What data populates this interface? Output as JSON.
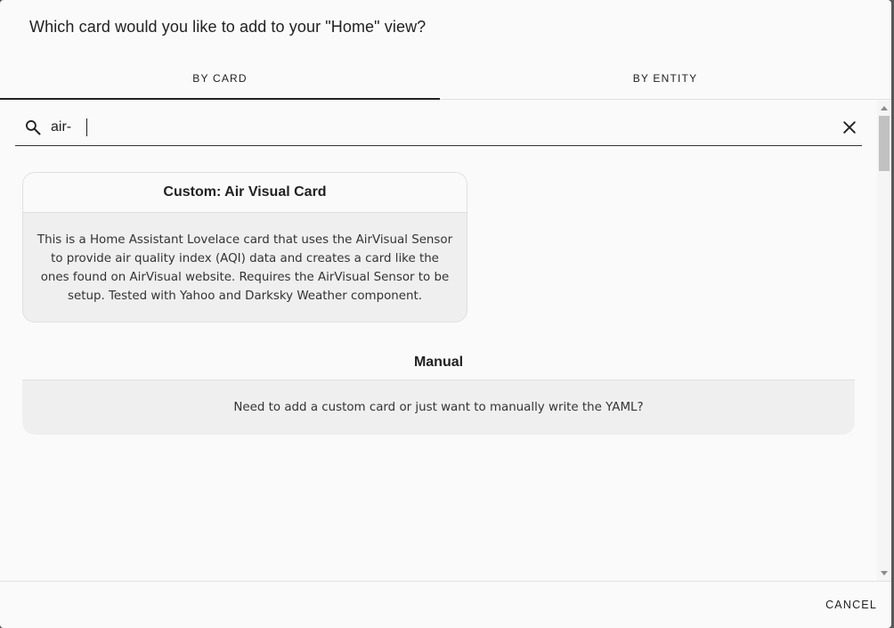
{
  "dialog": {
    "title": "Which card would you like to add to your \"Home\" view?"
  },
  "tabs": [
    {
      "label": "BY CARD",
      "selected": true
    },
    {
      "label": "BY ENTITY",
      "selected": false
    }
  ],
  "search": {
    "value": "air-",
    "placeholder": "",
    "icon": "search-icon",
    "clear_icon": "close-icon"
  },
  "cards": [
    {
      "title": "Custom: Air Visual Card",
      "description": "This is a Home Assistant Lovelace card that uses the AirVisual Sensor to provide air quality index (AQI) data and creates a card like the ones found on AirVisual website. Requires the AirVisual Sensor to be setup. Tested with Yahoo and Darksky Weather component."
    },
    {
      "title": "Manual",
      "description": "Need to add a custom card or just want to manually write the YAML?"
    }
  ],
  "actions": {
    "cancel_label": "CANCEL"
  },
  "colors": {
    "dialog_bg": "#fafafa",
    "card_body_bg": "#efefef",
    "text": "#212121",
    "divider": "#e0e0e0"
  }
}
